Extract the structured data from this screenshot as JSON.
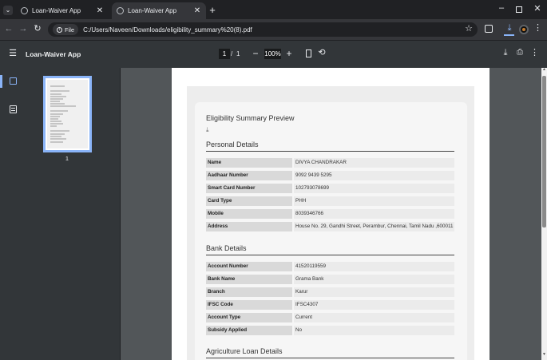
{
  "browser": {
    "tabs": [
      {
        "label": "Loan-Waiver App",
        "active": false
      },
      {
        "label": "Loan-Waiver App",
        "active": true
      }
    ],
    "address": {
      "scheme_chip": "File",
      "url": "C:/Users/Naveen/Downloads/eligibility_summary%20(8).pdf"
    },
    "icons": [
      "tab-search-icon",
      "close-icon",
      "new-tab-icon",
      "minimize-icon",
      "restore-icon",
      "window-close-icon",
      "back-icon",
      "forward-icon",
      "reload-icon",
      "bookmark-star-icon",
      "extensions-icon",
      "download-icon",
      "profile-icon",
      "menu-icon"
    ]
  },
  "pdf_viewer": {
    "title": "Loan-Waiver App",
    "page_current": "1",
    "page_separator": "/",
    "page_total": "1",
    "zoom": "100%",
    "thumbnail_number": "1"
  },
  "document": {
    "heading": "Eligibility Summary Preview",
    "sections": [
      {
        "title": "Personal Details",
        "rows": [
          {
            "label": "Name",
            "value": "DIVYA CHANDRAKAR"
          },
          {
            "label": "Aadhaar Number",
            "value": "9092 9439 5295"
          },
          {
            "label": "Smart Card Number",
            "value": "102793078699"
          },
          {
            "label": "Card Type",
            "value": "PHH"
          },
          {
            "label": "Mobile",
            "value": "8039346766"
          },
          {
            "label": "Address",
            "value": "House No. 29, Gandhi Street, Perambur, Chennai, Tamil Nadu ,600011"
          }
        ]
      },
      {
        "title": "Bank Details",
        "rows": [
          {
            "label": "Account Number",
            "value": "41520119559"
          },
          {
            "label": "Bank Name",
            "value": "Grama Bank"
          },
          {
            "label": "Branch",
            "value": "Karur"
          },
          {
            "label": "IFSC Code",
            "value": "IFSC4307"
          },
          {
            "label": "Account Type",
            "value": "Current"
          },
          {
            "label": "Subsidy Applied",
            "value": "No"
          }
        ]
      },
      {
        "title": "Agriculture Loan Details",
        "rows": []
      }
    ]
  },
  "colors": {
    "accent": "#8ab4f8",
    "download_active": "#8ab4f8"
  }
}
